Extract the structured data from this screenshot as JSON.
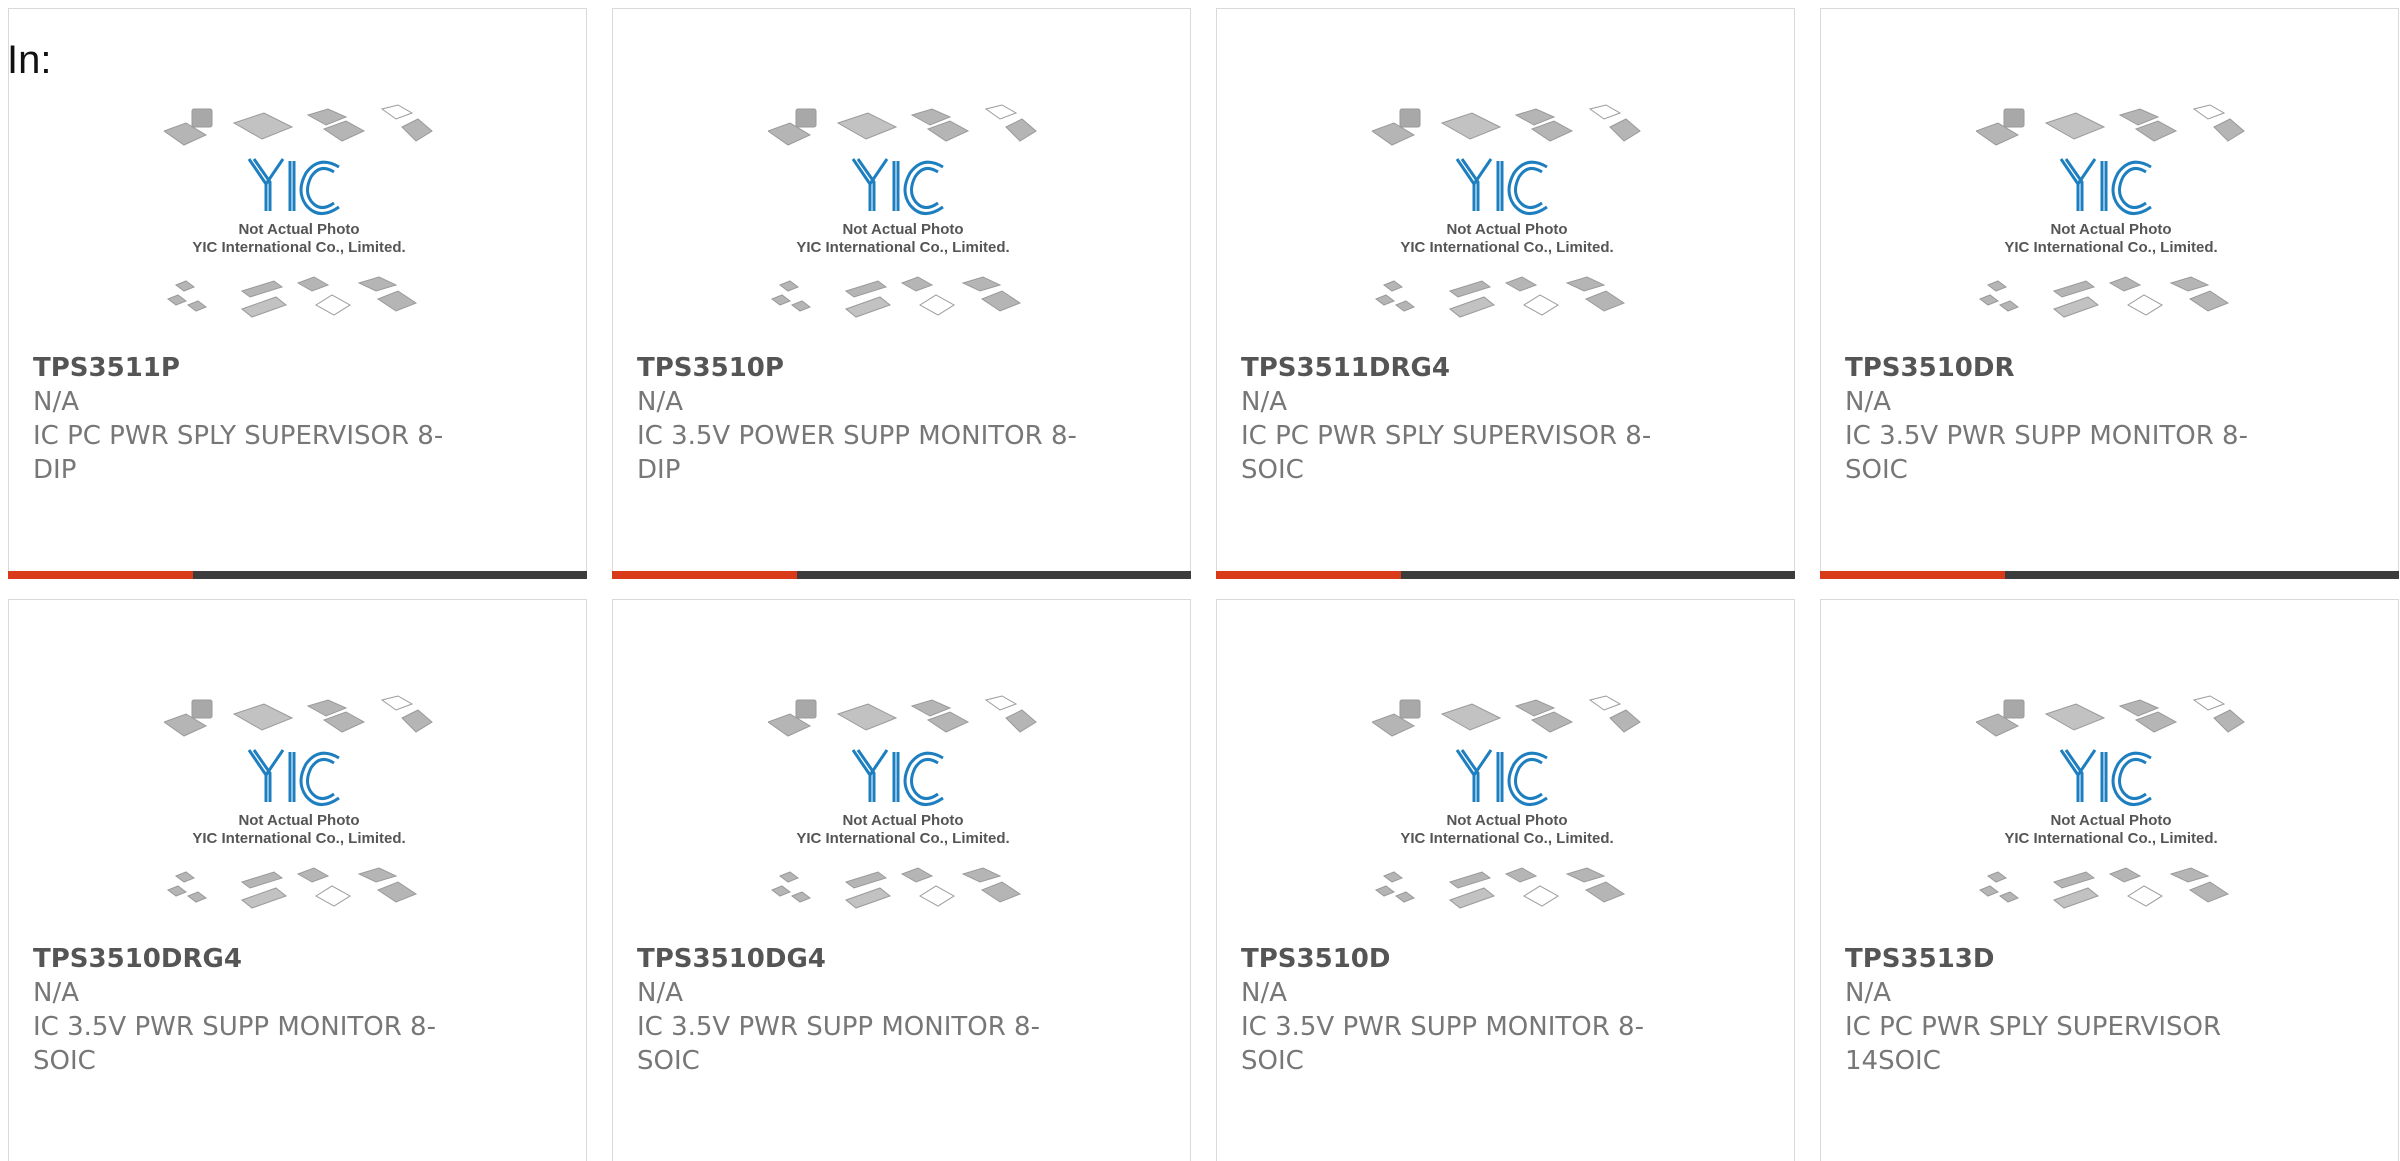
{
  "filter_label": "In:",
  "photo": {
    "brand": "YIC",
    "caption_line1": "Not Actual Photo",
    "caption_line2": "YIC International Co., Limited."
  },
  "colors": {
    "accent": "#d93a1a",
    "bar": "#3c3c3c",
    "logo_blue": "#1e7fc0"
  },
  "products": [
    {
      "part": "TPS3511P",
      "manufacturer": "N/A",
      "description": "IC PC PWR SPLY SUPERVISOR 8-DIP"
    },
    {
      "part": "TPS3510P",
      "manufacturer": "N/A",
      "description": "IC 3.5V POWER SUPP MONITOR 8-DIP"
    },
    {
      "part": "TPS3511DRG4",
      "manufacturer": "N/A",
      "description": "IC PC PWR SPLY SUPERVISOR 8-SOIC"
    },
    {
      "part": "TPS3510DR",
      "manufacturer": "N/A",
      "description": "IC 3.5V PWR SUPP MONITOR 8-SOIC"
    },
    {
      "part": "TPS3510DRG4",
      "manufacturer": "N/A",
      "description": "IC 3.5V PWR SUPP MONITOR 8-SOIC"
    },
    {
      "part": "TPS3510DG4",
      "manufacturer": "N/A",
      "description": "IC 3.5V PWR SUPP MONITOR 8-SOIC"
    },
    {
      "part": "TPS3510D",
      "manufacturer": "N/A",
      "description": "IC 3.5V PWR SUPP MONITOR 8-SOIC"
    },
    {
      "part": "TPS3513D",
      "manufacturer": "N/A",
      "description": "IC PC PWR SPLY SUPERVISOR 14SOIC"
    }
  ]
}
